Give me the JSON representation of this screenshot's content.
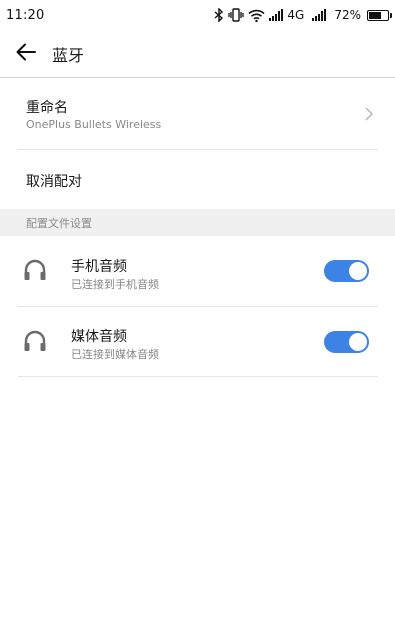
{
  "status_bar": {
    "time": "11:20",
    "network": "4G",
    "battery_percent": "72%",
    "battery_level": 0.72,
    "icons": [
      "bluetooth-icon",
      "vibrate-icon",
      "wifi-icon",
      "signal-icon",
      "signal-icon",
      "battery-icon"
    ]
  },
  "header": {
    "back_icon": "arrow-left-icon",
    "title": "蓝牙"
  },
  "device": {
    "rename_label": "重命名",
    "device_name": "OnePlus Bullets Wireless",
    "unpair_label": "取消配对"
  },
  "profiles": {
    "section_title": "配置文件设置",
    "items": [
      {
        "icon": "headphones-icon",
        "title": "手机音频",
        "subtitle": "已连接到手机音频",
        "enabled": true
      },
      {
        "icon": "headphones-icon",
        "title": "媒体音频",
        "subtitle": "已连接到媒体音频",
        "enabled": true
      }
    ]
  },
  "colors": {
    "toggle_on": "#3d83e6",
    "section_bg": "#f0f0f0",
    "subtext": "#888888"
  }
}
